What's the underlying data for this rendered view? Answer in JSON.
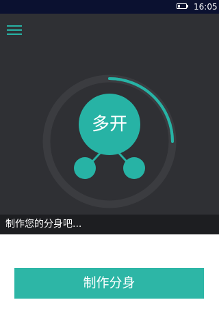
{
  "status_bar": {
    "time": "16:05",
    "battery_icon": "battery-icon"
  },
  "header": {
    "menu_icon": "hamburger-menu-icon"
  },
  "hero": {
    "logo_text": "多开",
    "caption": "制作您的分身吧..."
  },
  "actions": {
    "create_label": "制作分身"
  },
  "colors": {
    "accent": "#2db6a6",
    "hero_background": "#2f3034",
    "status_bar": "#0b1130"
  }
}
